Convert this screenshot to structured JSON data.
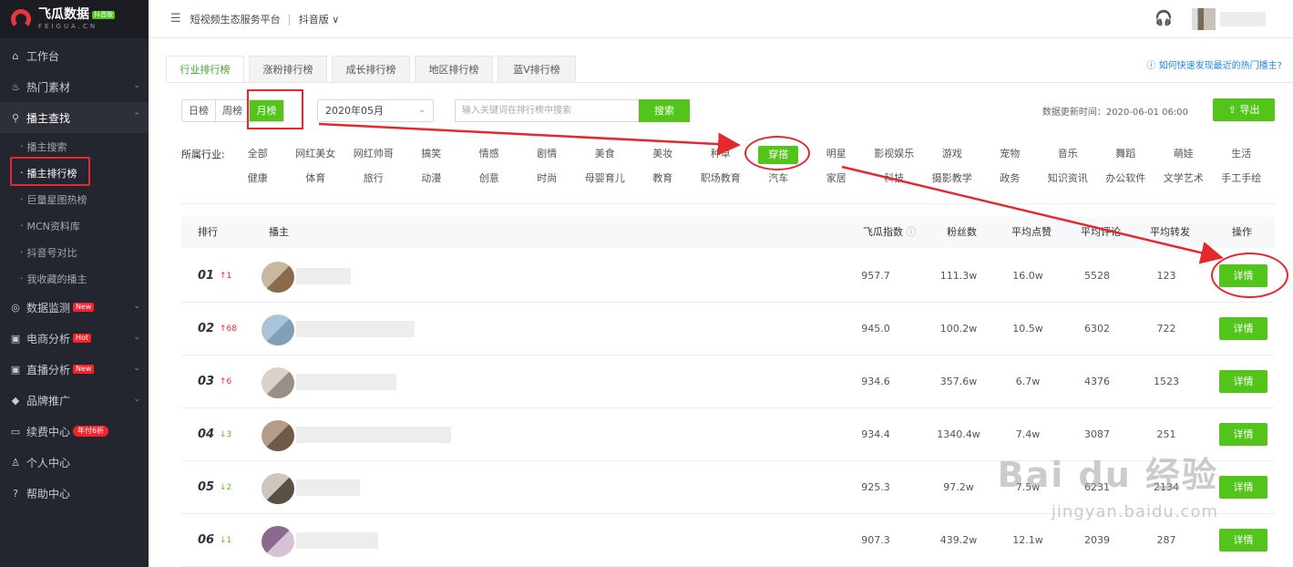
{
  "brand": {
    "name": "飞瓜数据",
    "badge": "抖音版",
    "sub": "FEIGUA.CN",
    "accent": "#52c41a",
    "highlight": "#e3282e"
  },
  "header": {
    "menu_icon": "menu-fold-icon",
    "platform": "短视频生态服务平台",
    "separator": "|",
    "edition": "抖音版",
    "edition_caret": "∨"
  },
  "sidebar": {
    "items": [
      {
        "label": "工作台",
        "icon": "home-icon"
      },
      {
        "label": "热门素材",
        "icon": "fire-icon"
      },
      {
        "label": "播主查找",
        "icon": "search-icon"
      },
      {
        "label": "数据监测",
        "icon": "monitor-icon",
        "badge": "New"
      },
      {
        "label": "电商分析",
        "icon": "shop-icon",
        "badge": "Hot"
      },
      {
        "label": "直播分析",
        "icon": "live-icon",
        "badge": "New"
      },
      {
        "label": "品牌推广",
        "icon": "diamond-icon"
      },
      {
        "label": "续费中心",
        "icon": "card-icon",
        "badge": "年付6折"
      },
      {
        "label": "个人中心",
        "icon": "user-icon"
      },
      {
        "label": "帮助中心",
        "icon": "help-icon"
      }
    ],
    "sub_items": [
      "播主搜索",
      "播主排行榜",
      "巨量星图热榜",
      "MCN资料库",
      "抖音号对比",
      "我收藏的播主"
    ]
  },
  "tabs": [
    "行业排行榜",
    "涨粉排行榜",
    "成长排行榜",
    "地区排行榜",
    "蓝V排行榜"
  ],
  "help_link": "如何快速发现最近的热门播主?",
  "period": {
    "options": [
      "日榜",
      "周榜",
      "月榜"
    ],
    "selected": "月榜"
  },
  "month_select": "2020年05月",
  "search": {
    "placeholder": "输入关键词在排行榜中搜索",
    "button": "搜索"
  },
  "update_time": "数据更新时间：2020-06-01 06:00",
  "export_label": "导出",
  "industry": {
    "label": "所属行业:",
    "row1": [
      "全部",
      "网红美女",
      "网红帅哥",
      "搞笑",
      "情感",
      "剧情",
      "美食",
      "美妆",
      "种草",
      "穿搭",
      "明星",
      "影视娱乐",
      "游戏",
      "宠物",
      "音乐",
      "舞蹈",
      "萌娃",
      "生活"
    ],
    "row2": [
      "健康",
      "体育",
      "旅行",
      "动漫",
      "创意",
      "时尚",
      "母婴育儿",
      "教育",
      "职场教育",
      "汽车",
      "家居",
      "科技",
      "摄影教学",
      "政务",
      "知识资讯",
      "办公软件",
      "文学艺术",
      "手工手绘"
    ],
    "selected": "穿搭"
  },
  "table": {
    "headers": {
      "rank": "排行",
      "streamer": "播主",
      "index": "飞瓜指数",
      "fans": "粉丝数",
      "likes": "平均点赞",
      "comments": "平均评论",
      "shares": "平均转发",
      "action": "操作"
    },
    "detail_label": "详情",
    "rows": [
      {
        "rank": "01",
        "change": "↑1",
        "dir": "up",
        "index": "957.7",
        "fans": "111.3w",
        "likes": "16.0w",
        "comments": "5528",
        "shares": "123"
      },
      {
        "rank": "02",
        "change": "↑68",
        "dir": "up",
        "index": "945.0",
        "fans": "100.2w",
        "likes": "10.5w",
        "comments": "6302",
        "shares": "722"
      },
      {
        "rank": "03",
        "change": "↑6",
        "dir": "up",
        "index": "934.6",
        "fans": "357.6w",
        "likes": "6.7w",
        "comments": "4376",
        "shares": "1523"
      },
      {
        "rank": "04",
        "change": "↓3",
        "dir": "down",
        "index": "934.4",
        "fans": "1340.4w",
        "likes": "7.4w",
        "comments": "3087",
        "shares": "251"
      },
      {
        "rank": "05",
        "change": "↓2",
        "dir": "down",
        "index": "925.3",
        "fans": "97.2w",
        "likes": "7.5w",
        "comments": "6231",
        "shares": "2134"
      },
      {
        "rank": "06",
        "change": "↓1",
        "dir": "down",
        "index": "907.3",
        "fans": "439.2w",
        "likes": "12.1w",
        "comments": "2039",
        "shares": "287"
      }
    ]
  },
  "watermark": {
    "line1": "Bai du 经验",
    "line2": "jingyan.baidu.com"
  }
}
